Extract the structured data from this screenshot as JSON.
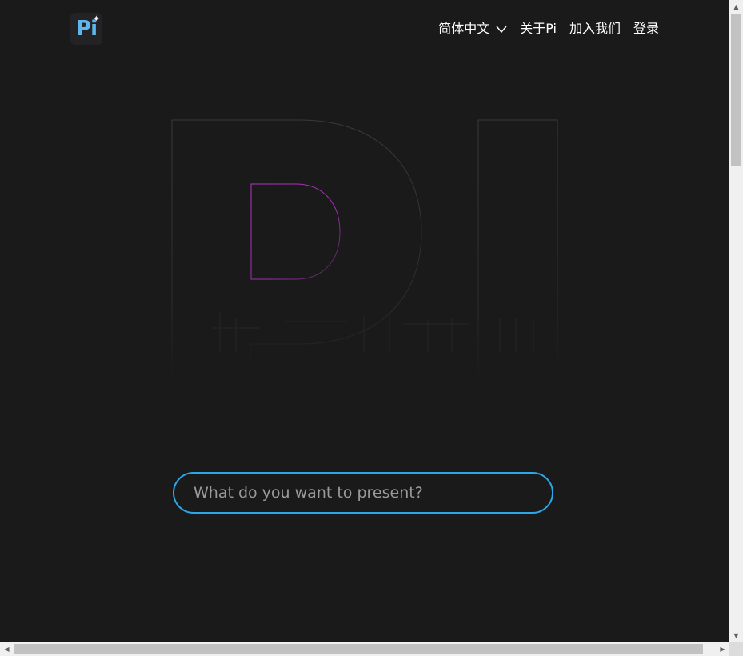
{
  "header": {
    "logo_text": "Pi",
    "logo_spark": "✦",
    "nav": {
      "language": "简体中文",
      "about": "关于Pi",
      "join": "加入我们",
      "login": "登录"
    }
  },
  "hero": {
    "outline_text": "PI"
  },
  "search": {
    "placeholder": "What do you want to present?"
  },
  "colors": {
    "background": "#1a1a1a",
    "accent": "#2ca7e8",
    "logo": "#5fb6ec",
    "outline_highlight": "#b833c9"
  }
}
